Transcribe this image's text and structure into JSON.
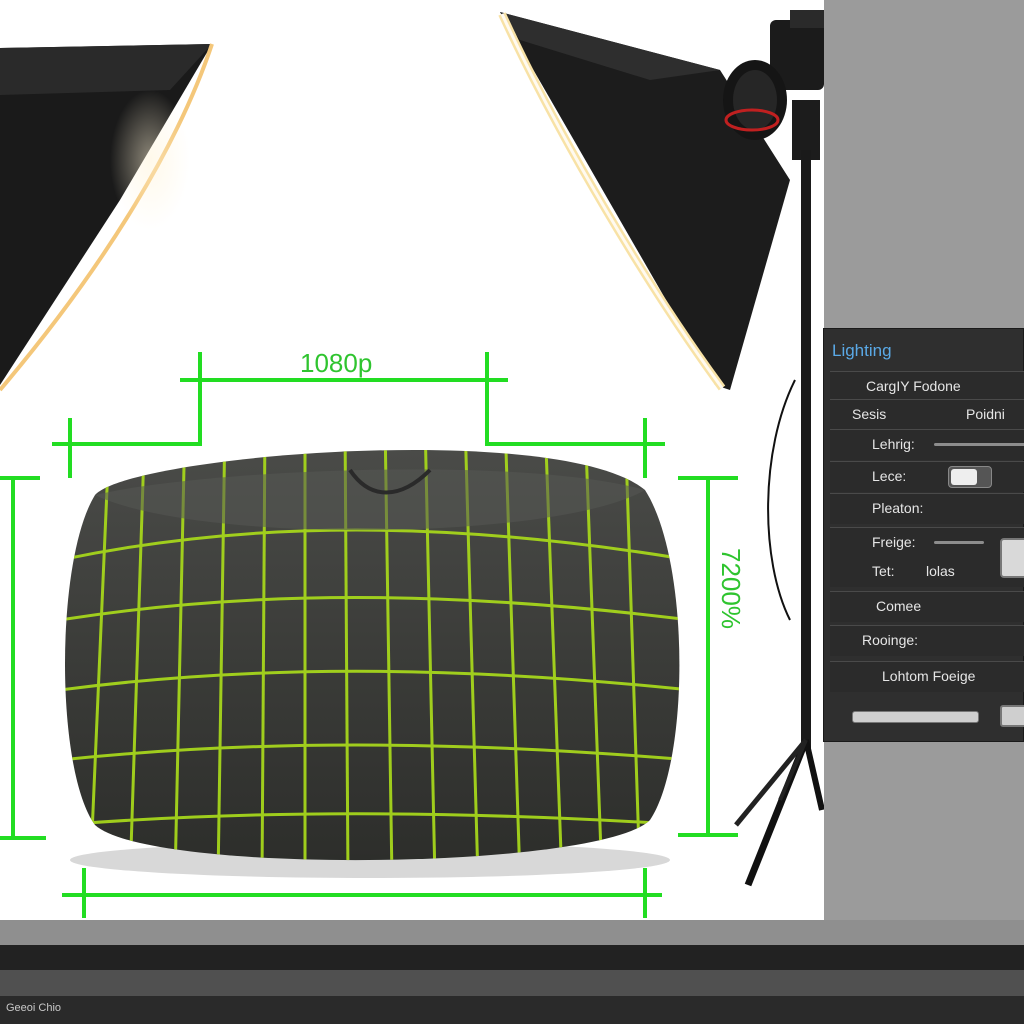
{
  "scene": {
    "dimension_width_label": "1080p",
    "dimension_height_label": "7200%",
    "accent_color": "#22dd22"
  },
  "lighting_panel": {
    "title": "Lighting",
    "rows": [
      {
        "label": "CargIY Fodone"
      },
      {
        "label": "Sesis",
        "value": "Poidni"
      },
      {
        "label": "Lehrig:"
      },
      {
        "label": "Lece:"
      },
      {
        "label": "Pleaton:"
      },
      {
        "label": "Freige:"
      },
      {
        "label": "Tet:",
        "value": "lolas"
      },
      {
        "label": "Comee"
      },
      {
        "label": "Rooinge:"
      },
      {
        "label": "Lohtom Foeige"
      }
    ]
  },
  "status_bar": {
    "text": "Geeoi Chio"
  }
}
